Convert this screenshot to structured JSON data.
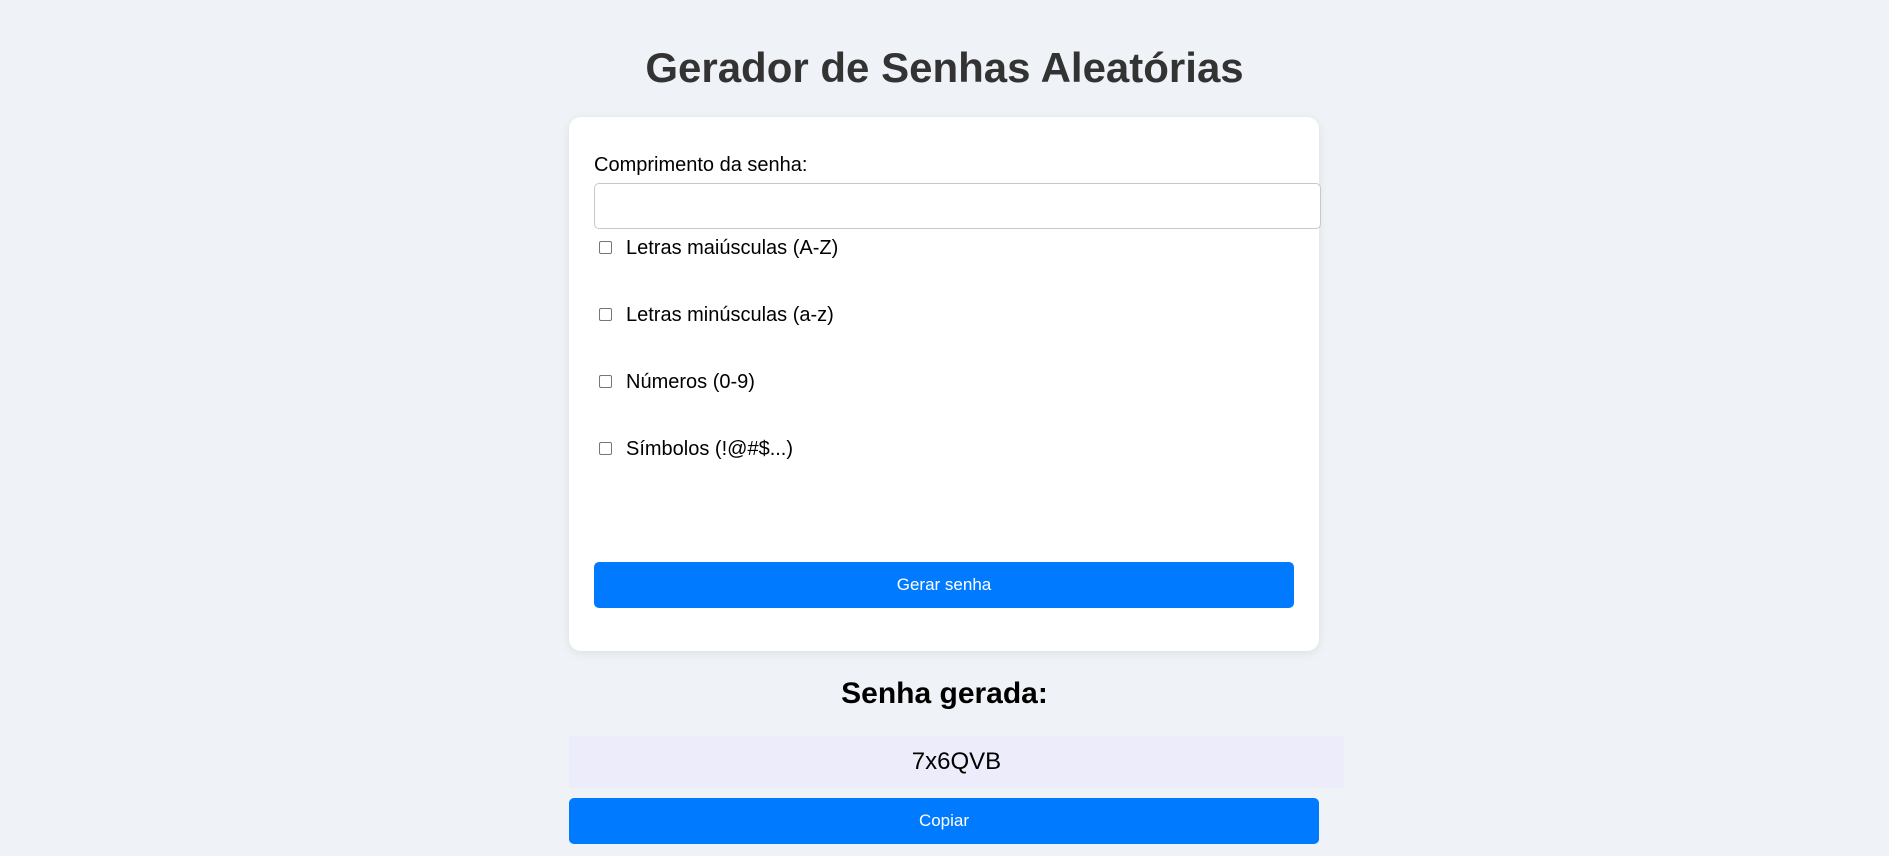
{
  "page": {
    "title": "Gerador de Senhas Aleatórias"
  },
  "form": {
    "length_label": "Comprimento da senha:",
    "length_value": "",
    "options": [
      {
        "label": "Letras maiúsculas (A-Z)",
        "checked": false
      },
      {
        "label": "Letras minúsculas (a-z)",
        "checked": false
      },
      {
        "label": "Números (0-9)",
        "checked": false
      },
      {
        "label": "Símbolos (!@#$...)",
        "checked": false
      }
    ],
    "generate_label": "Gerar senha"
  },
  "result": {
    "title": "Senha gerada:",
    "password": "7x6QVB",
    "copy_label": "Copiar"
  },
  "colors": {
    "background": "#eff2f6",
    "accent": "#007bff",
    "password_bg": "#ececfa"
  }
}
